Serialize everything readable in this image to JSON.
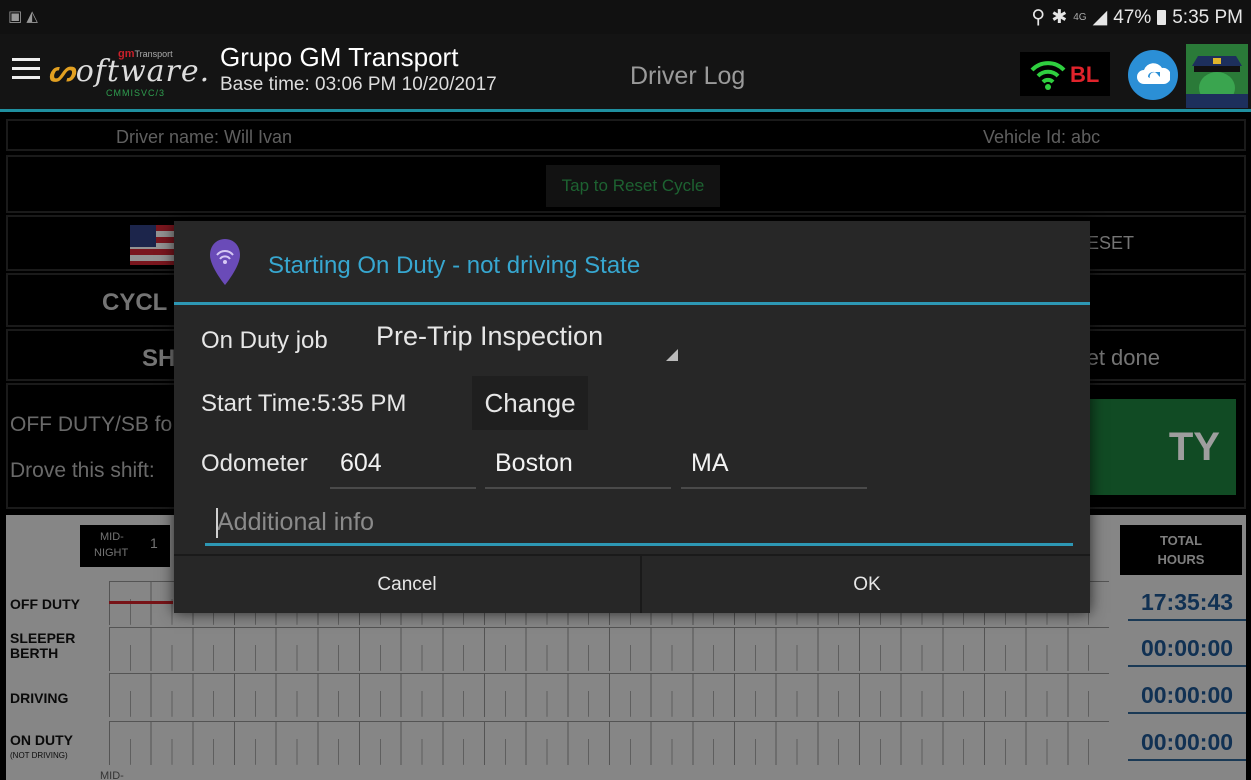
{
  "status_bar": {
    "battery": "47%",
    "time": "5:35 PM",
    "network": "4G"
  },
  "app_bar": {
    "logo_text_pre": "",
    "logo_text": "oftware.",
    "logo_top": "gm",
    "logo_top_small": "Transport",
    "logo_sub": "CMMISVC/3",
    "company": "Grupo GM Transport",
    "base_time": "Base time: 03:06 PM 10/20/2017",
    "screen_title": "Driver Log",
    "bl_label": "BL"
  },
  "main": {
    "driver_name": "Driver name: Will Ivan",
    "vehicle_id": "Vehicle Id: abc",
    "reset_cycle": "Tap to Reset Cycle",
    "reset_tab_partial": "ESET",
    "cycle_partial": "CYCL",
    "shift_partial": "SH",
    "done_partial": "et done",
    "off_duty_partial": "OFF DUTY/SB fo",
    "drove_partial": "Drove this shift:",
    "duty_button_partial": "TY"
  },
  "grid": {
    "midnight_l1": "MID-",
    "midnight_l2": "NIGHT",
    "hour_1": "1",
    "total_hours_l1": "TOTAL",
    "total_hours_l2": "HOURS",
    "rows": [
      {
        "label": "OFF DUTY",
        "sub": "",
        "total": "17:35:43"
      },
      {
        "label": "SLEEPER BERTH",
        "sub": "",
        "total": "00:00:00"
      },
      {
        "label": "DRIVING",
        "sub": "",
        "total": "00:00:00"
      },
      {
        "label": "ON DUTY",
        "sub": "(NOT DRIVING)",
        "total": "00:00:00"
      }
    ],
    "bottom_mid": "MID-"
  },
  "dialog": {
    "title": "Starting On Duty - not driving State",
    "on_duty_job_label": "On Duty job",
    "on_duty_job_value": "Pre-Trip Inspection",
    "start_time_label": "Start Time:5:35 PM",
    "change_label": "Change",
    "odometer_label": "Odometer",
    "odometer_value": "604",
    "city_value": "Boston",
    "state_value": "MA",
    "additional_placeholder": "Additional info",
    "cancel_label": "Cancel",
    "ok_label": "OK"
  },
  "colors": {
    "accent": "#2d97b4",
    "title_blue": "#37a7d0",
    "duty_green": "#1c7a3b",
    "total_blue": "#1c4f86",
    "offduty_red": "#c01f26"
  }
}
